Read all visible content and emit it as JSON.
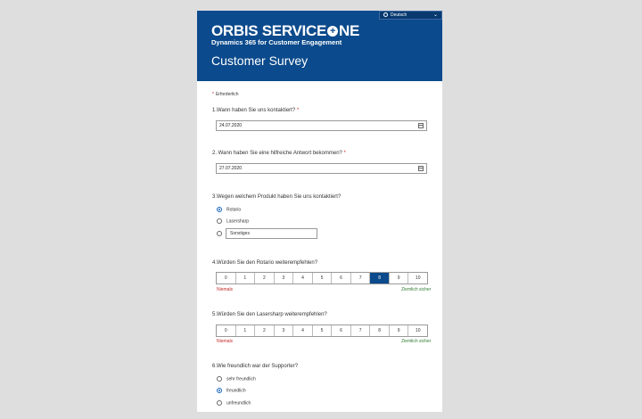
{
  "header": {
    "language": "Deutsch",
    "logo_left": "ORBIS SERVICE",
    "logo_plus": "+",
    "logo_right": "NE",
    "tagline": "Dynamics 365 for Customer Engagement",
    "title": "Customer Survey"
  },
  "required_note": "Erforderlich",
  "q1": {
    "label": "1.Wann haben Sie uns kontaktiert?",
    "star": " *",
    "value": "24.07.2020"
  },
  "q2": {
    "label": "2. Wann haben Sie eine hilfreiche Antwort bekommen?",
    "star": " *",
    "value": "27.07.2020"
  },
  "q3": {
    "label": "3.Wegen welchem Produkt haben Sie uns kontaktiert?",
    "options": [
      "Rotario",
      "Lasersharp"
    ],
    "selected": 0,
    "other_value": "Sonstiges"
  },
  "q4": {
    "label": "4.Würden Sie den Rotario weiterempfehlen?",
    "scale": [
      "0",
      "1",
      "2",
      "3",
      "4",
      "5",
      "6",
      "7",
      "8",
      "9",
      "10"
    ],
    "selected": 8,
    "low_label": "Niemals",
    "high_label": "Ziemlich sicher"
  },
  "q5": {
    "label": "5.Würden Sie den Lasersharp weiterempfehlen?",
    "scale": [
      "0",
      "1",
      "2",
      "3",
      "4",
      "5",
      "6",
      "7",
      "8",
      "9",
      "10"
    ],
    "selected": null,
    "low_label": "Niemals",
    "high_label": "Ziemlich sicher"
  },
  "q6": {
    "label": "6.Wie freundlich war der Supporter?",
    "options": [
      "sehr freundlich",
      "freundlich",
      "unfreundlich"
    ],
    "selected": 1
  },
  "colors": {
    "brand": "#0b4a8c",
    "required": "#c62828",
    "high": "#2e7d32"
  }
}
